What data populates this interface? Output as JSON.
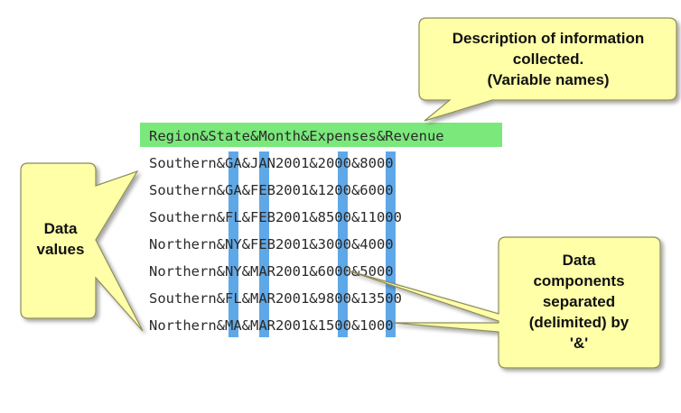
{
  "header_line": "Region&State&Month&Expenses&Revenue",
  "data_rows": [
    "Southern&GA&JAN2001&2000&8000",
    "Southern&GA&FEB2001&1200&6000",
    "Southern&FL&FEB2001&8500&11000",
    "Northern&NY&FEB2001&3000&4000",
    "Northern&NY&MAR2001&6000&5000",
    "Southern&FL&MAR2001&9800&13500",
    "Northern&MA&MAR2001&1500&1000"
  ],
  "callouts": {
    "variable_names": [
      "Description of information",
      "collected.",
      "(Variable names)"
    ],
    "data_values": [
      "Data",
      "values"
    ],
    "delimiter": [
      "Data",
      "components",
      "separated",
      "(delimited) by",
      "'&'"
    ]
  },
  "colors": {
    "header_highlight": "#7be87b",
    "delimiter_highlight": "#5fa8e8",
    "callout_fill": "#ffffa8",
    "callout_stroke": "#8c8c5a"
  }
}
